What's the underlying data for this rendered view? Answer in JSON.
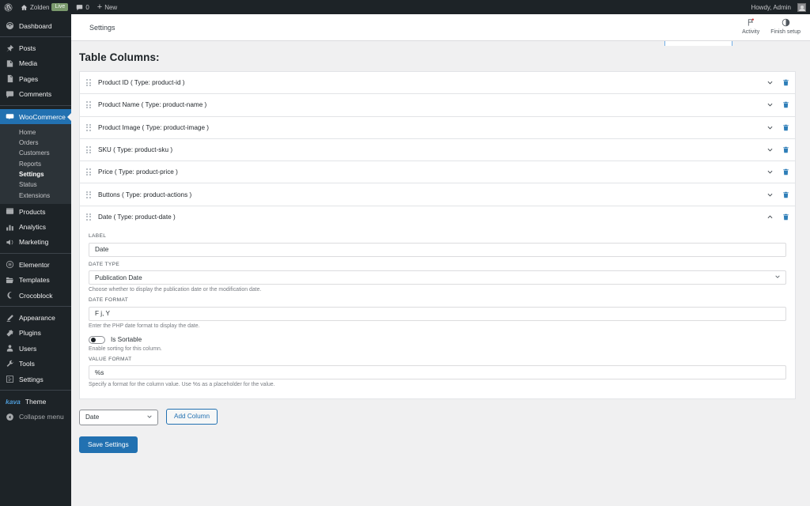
{
  "adminbar": {
    "wp_logo": "wordpress-logo-icon",
    "site_name": "Zolden",
    "live_badge": "Live",
    "comments_count": "0",
    "new_label": "New",
    "howdy": "Howdy, Admin"
  },
  "sidebar": {
    "items": [
      {
        "label": "Dashboard",
        "icon": "dashboard-icon"
      },
      {
        "label": "Posts",
        "icon": "pin-icon"
      },
      {
        "label": "Media",
        "icon": "media-icon"
      },
      {
        "label": "Pages",
        "icon": "page-icon"
      },
      {
        "label": "Comments",
        "icon": "comment-icon"
      },
      {
        "label": "WooCommerce",
        "icon": "woocommerce-icon",
        "current": true
      },
      {
        "label": "Products",
        "icon": "products-icon"
      },
      {
        "label": "Analytics",
        "icon": "analytics-icon"
      },
      {
        "label": "Marketing",
        "icon": "marketing-icon"
      },
      {
        "label": "Elementor",
        "icon": "elementor-icon"
      },
      {
        "label": "Templates",
        "icon": "templates-icon"
      },
      {
        "label": "Crocoblock",
        "icon": "crocoblock-icon"
      },
      {
        "label": "Appearance",
        "icon": "appearance-icon"
      },
      {
        "label": "Plugins",
        "icon": "plugins-icon"
      },
      {
        "label": "Users",
        "icon": "users-icon"
      },
      {
        "label": "Tools",
        "icon": "tools-icon"
      },
      {
        "label": "Settings",
        "icon": "settings-icon"
      },
      {
        "label": "Theme",
        "icon": "kava-logo",
        "brand": "kava"
      },
      {
        "label": "Collapse menu",
        "icon": "collapse-icon"
      }
    ],
    "woocommerce_submenu": [
      {
        "label": "Home"
      },
      {
        "label": "Orders"
      },
      {
        "label": "Customers"
      },
      {
        "label": "Reports"
      },
      {
        "label": "Settings",
        "current": true
      },
      {
        "label": "Status"
      },
      {
        "label": "Extensions"
      }
    ]
  },
  "header": {
    "breadcrumb": "Settings",
    "actions": [
      {
        "label": "Activity",
        "icon": "flag-icon"
      },
      {
        "label": "Finish setup",
        "icon": "half-circle-icon"
      }
    ]
  },
  "main": {
    "page_title": "Table Columns:",
    "columns": [
      {
        "label": "Product ID ( Type: product-id )",
        "expanded": false
      },
      {
        "label": "Product Name ( Type: product-name )",
        "expanded": false
      },
      {
        "label": "Product Image ( Type: product-image )",
        "expanded": false
      },
      {
        "label": "SKU ( Type: product-sku )",
        "expanded": false
      },
      {
        "label": "Price ( Type: product-price )",
        "expanded": false
      },
      {
        "label": "Buttons ( Type: product-actions )",
        "expanded": false
      },
      {
        "label": "Date ( Type: product-date )",
        "expanded": true
      }
    ],
    "expanded_panel": {
      "label_field_label": "LABEL",
      "label_field_value": "Date",
      "date_type_label": "DATE TYPE",
      "date_type_value": "Publication Date",
      "date_type_hint": "Choose whether to display the publication date or the modification date.",
      "date_format_label": "DATE FORMAT",
      "date_format_value": "F j, Y",
      "date_format_hint": "Enter the PHP date format to display the date.",
      "sortable_label": "Is Sortable",
      "sortable_hint": "Enable sorting for this column.",
      "sortable_on": false,
      "value_format_label": "VALUE FORMAT",
      "value_format_value": "%s",
      "value_format_hint": "Specify a format for the column value. Use %s as a placeholder for the value."
    },
    "add_column_select_value": "Date",
    "add_column_button": "Add Column",
    "save_button": "Save Settings"
  },
  "colors": {
    "accent": "#2271b1",
    "sidebar_bg": "#1d2327",
    "submenu_bg": "#2c3338",
    "trash": "#2e7eb8",
    "live_badge": "#7b9a6d"
  }
}
